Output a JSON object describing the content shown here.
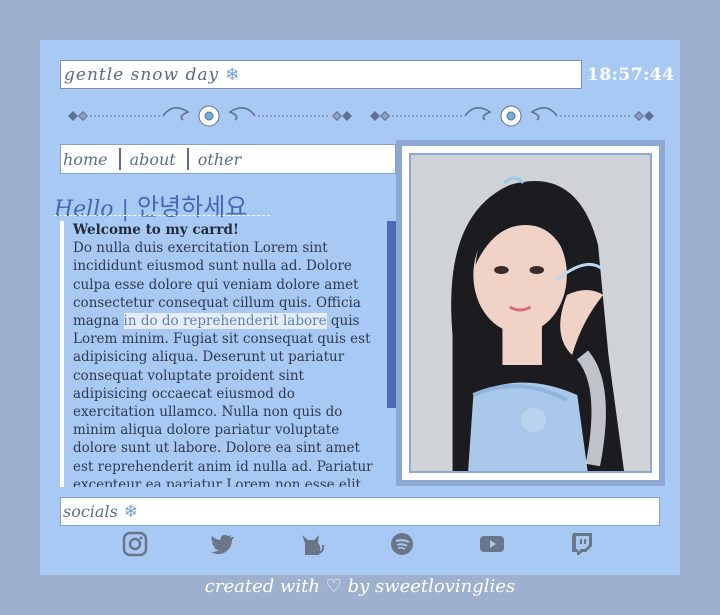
{
  "header": {
    "title": "gentle snow day",
    "clock": "18:57:44"
  },
  "nav": {
    "items": [
      "home",
      "about",
      "other"
    ]
  },
  "hello": {
    "title_en": "Hello",
    "separator": "|",
    "title_ko": "안녕하세요"
  },
  "body": {
    "heading": "Welcome to my carrd!",
    "text_before": "Do nulla duis exercitation Lorem sint incididunt eiusmod sunt nulla ad. Dolore culpa esse dolore qui veniam dolore amet consectetur consequat cillum quis. Officia magna ",
    "highlighted": "in do do reprehenderit labore",
    "text_after": " quis Lorem minim. Fugiat sit consequat quis est adipisicing aliqua. Deserunt ut pariatur consequat voluptate proident sint adipisicing occaecat eiusmod do exercitation ullamco. Nulla non quis do minim aliqua dolore pariatur voluptate dolore sunt ut labore. Dolore ea sint amet est reprehenderit anim id nulla ad. Pariatur excepteur ea pariatur Lorem non esse elit esse. Ea culpa pariatur"
  },
  "socials": {
    "label": "socials",
    "icons": [
      "instagram-icon",
      "twitter-icon",
      "cat-icon",
      "spotify-icon",
      "youtube-icon",
      "twitch-icon"
    ]
  },
  "footer": {
    "text": "created with ♡ by sweetlovinglies"
  },
  "colors": {
    "background": "#9db0cd",
    "card": "#a9c9f5",
    "accent": "#4f6bb8"
  }
}
